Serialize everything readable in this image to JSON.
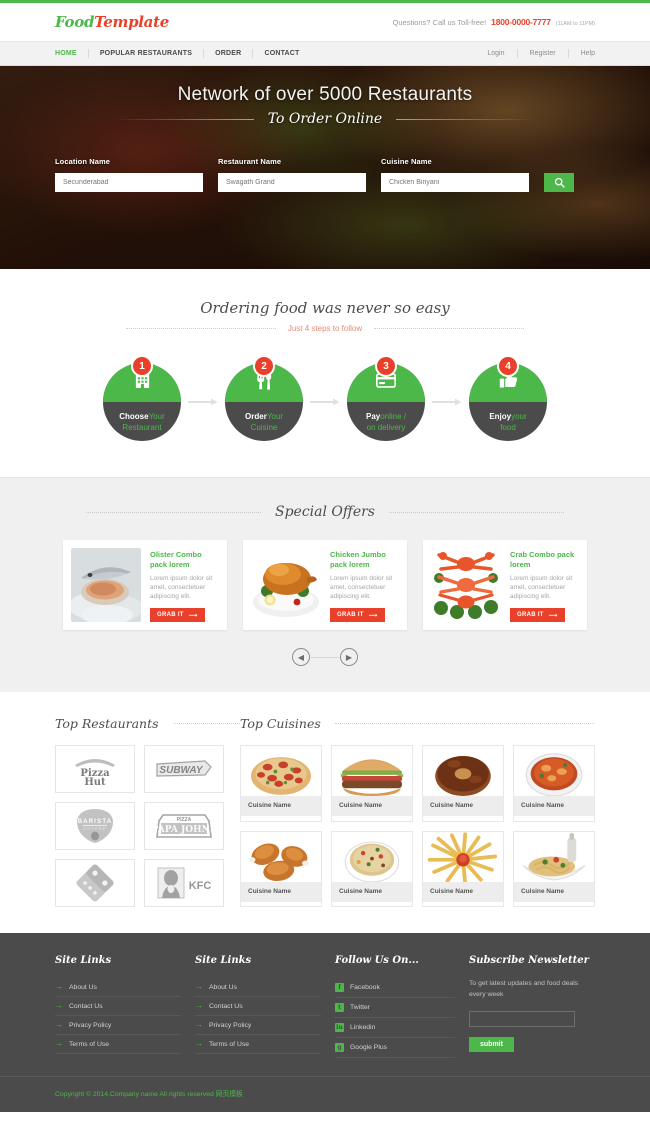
{
  "header": {
    "logo_food": "Food",
    "logo_template": "Template",
    "questions_label": "Questions? Call us Toll-free!",
    "phone": "1800-0000-7777",
    "phone_hours": "(11AM to 11PM)"
  },
  "nav": {
    "main": [
      {
        "label": "HOME",
        "active": true
      },
      {
        "label": "POPULAR RESTAURANTS",
        "active": false
      },
      {
        "label": "ORDER",
        "active": false
      },
      {
        "label": "CONTACT",
        "active": false
      }
    ],
    "right": [
      {
        "label": "Login"
      },
      {
        "label": "Register"
      },
      {
        "label": "Help"
      }
    ]
  },
  "hero": {
    "title": "Network of over 5000 Restaurants",
    "subtitle": "To Order Online",
    "fields": [
      {
        "label": "Location Name",
        "placeholder": "Secunderabad"
      },
      {
        "label": "Restaurant Name",
        "placeholder": "Swagath Grand"
      },
      {
        "label": "Cuisine Name",
        "placeholder": "Chicken Biriyani"
      }
    ],
    "search_icon": "search-icon"
  },
  "steps_section": {
    "heading": "Ordering food was never so easy",
    "subheading": "Just 4 steps to follow",
    "steps": [
      {
        "number": "1",
        "icon": "building-icon",
        "line1_bold": "Choose",
        "line1_rest": "Your",
        "line2": "Restaurant"
      },
      {
        "number": "2",
        "icon": "cutlery-icon",
        "line1_bold": "Order",
        "line1_rest": "Your",
        "line2": "Cuisine"
      },
      {
        "number": "3",
        "icon": "credit-card-icon",
        "line1_bold": "Pay",
        "line1_rest": "online /",
        "line2": "on delivery"
      },
      {
        "number": "4",
        "icon": "thumbs-up-icon",
        "line1_bold": "Enjoy",
        "line1_rest": "your",
        "line2": "food"
      }
    ]
  },
  "offers": {
    "heading": "Special Offers",
    "cards": [
      {
        "title": "Olister Combo pack lorem",
        "desc": "Lorem ipsum dolor sit amet, consectetuer adipiscing elit.",
        "button": "GRAB IT",
        "image": "oyster-on-ice-photo"
      },
      {
        "title": "Chicken Jumbo pack lorem",
        "desc": "Lorem ipsum dolor sit amet, consectetuer adipiscing elit.",
        "button": "GRAB IT",
        "image": "roast-chicken-photo"
      },
      {
        "title": "Crab Combo pack lorem",
        "desc": "Lorem ipsum dolor sit amet, consectetuer adipiscing elit.",
        "button": "GRAB IT",
        "image": "crab-platter-photo"
      }
    ],
    "prev_icon": "chevron-left-icon",
    "next_icon": "chevron-right-icon"
  },
  "tops": {
    "restaurants_heading": "Top Restaurants",
    "cuisines_heading": "Top Cuisines",
    "restaurants": [
      {
        "name": "Pizza Hut"
      },
      {
        "name": "SUBWAY"
      },
      {
        "name": "BARISTA"
      },
      {
        "name": "PAPA JOHNS"
      },
      {
        "name": "Domino's"
      },
      {
        "name": "KFC"
      }
    ],
    "cuisines": [
      {
        "label": "Cuisine Name",
        "image": "pepperoni-pizza-photo"
      },
      {
        "label": "Cuisine Name",
        "image": "hamburger-photo"
      },
      {
        "label": "Cuisine Name",
        "image": "donut-photo"
      },
      {
        "label": "Cuisine Name",
        "image": "curry-bowl-photo"
      },
      {
        "label": "Cuisine Name",
        "image": "fried-chicken-photo"
      },
      {
        "label": "Cuisine Name",
        "image": "fried-rice-bowl-photo"
      },
      {
        "label": "Cuisine Name",
        "image": "french-fries-photo"
      },
      {
        "label": "Cuisine Name",
        "image": "pasta-plate-photo"
      }
    ]
  },
  "footer": {
    "col1": {
      "title": "Site Links",
      "links": [
        "About Us",
        "Contact Us",
        "Privacy Policy",
        "Terms of Use"
      ]
    },
    "col2": {
      "title": "Site Links",
      "links": [
        "About Us",
        "Contact Us",
        "Privacy Policy",
        "Terms of Use"
      ]
    },
    "social": {
      "title": "Follow Us On...",
      "items": [
        {
          "label": "Facebook",
          "glyph": "f",
          "icon": "facebook-icon"
        },
        {
          "label": "Twitter",
          "glyph": "t",
          "icon": "twitter-icon"
        },
        {
          "label": "Linkedin",
          "glyph": "in",
          "icon": "linkedin-icon"
        },
        {
          "label": "Google Plus",
          "glyph": "g",
          "icon": "google-plus-icon"
        }
      ]
    },
    "newsletter": {
      "title": "Subscribe Newsletter",
      "text": "To get latest updates and food deals every week",
      "input_value": "",
      "button": "submit"
    },
    "copyright": "Copyright © 2014.Company name All rights reserved 网页模板"
  }
}
